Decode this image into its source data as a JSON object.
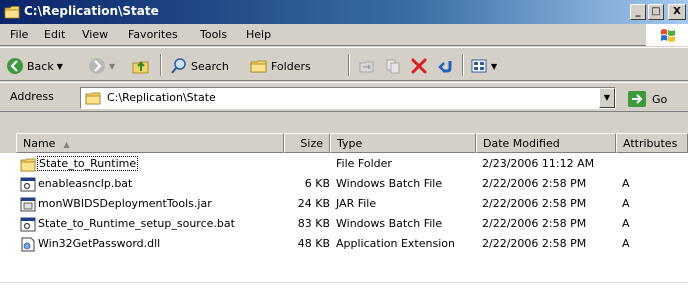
{
  "window": {
    "title": "C:\\Replication\\State",
    "min_glyph": "_",
    "max_glyph": "□",
    "close_glyph": "X"
  },
  "menu": {
    "items": [
      {
        "label": "File",
        "key": "F"
      },
      {
        "label": "Edit",
        "key": "E"
      },
      {
        "label": "View",
        "key": "V"
      },
      {
        "label": "Favorites",
        "key": "a"
      },
      {
        "label": "Tools",
        "key": "T"
      },
      {
        "label": "Help",
        "key": "H"
      }
    ]
  },
  "toolbar": {
    "back_label": "Back",
    "search_label": "Search",
    "folders_label": "Folders",
    "icons": {
      "back": "back-arrow-icon",
      "forward": "forward-arrow-icon",
      "up": "up-folder-icon",
      "search": "search-icon",
      "folders": "folders-icon",
      "move_to": "move-to-icon",
      "copy_to": "copy-to-icon",
      "delete": "delete-icon",
      "undo": "undo-icon",
      "views": "views-icon"
    },
    "colors": {
      "back_green": "#3c9a3c",
      "delete_red": "#e0201c",
      "undo_blue": "#1f5fbf"
    }
  },
  "address": {
    "label": "Address",
    "value": "C:\\Replication\\State",
    "go_label": "Go"
  },
  "columns": {
    "name": "Name",
    "size": "Size",
    "type": "Type",
    "date": "Date Modified",
    "attributes": "Attributes"
  },
  "files": [
    {
      "name": "State_to_Runtime",
      "size": "",
      "type": "File Folder",
      "date": "2/23/2006 11:12 AM",
      "attr": "",
      "icon": "folder-icon"
    },
    {
      "name": "enableasnclp.bat",
      "size": "6 KB",
      "type": "Windows Batch File",
      "date": "2/22/2006 2:58 PM",
      "attr": "A",
      "icon": "batch-file-icon"
    },
    {
      "name": "monWBIDSDeploymentTools.jar",
      "size": "24 KB",
      "type": "JAR File",
      "date": "2/22/2006 2:58 PM",
      "attr": "A",
      "icon": "jar-file-icon"
    },
    {
      "name": "State_to_Runtime_setup_source.bat",
      "size": "83 KB",
      "type": "Windows Batch File",
      "date": "2/22/2006 2:58 PM",
      "attr": "A",
      "icon": "batch-file-icon"
    },
    {
      "name": "Win32GetPassword.dll",
      "size": "48 KB",
      "type": "Application Extension",
      "date": "2/22/2006 2:58 PM",
      "attr": "A",
      "icon": "dll-file-icon"
    }
  ]
}
